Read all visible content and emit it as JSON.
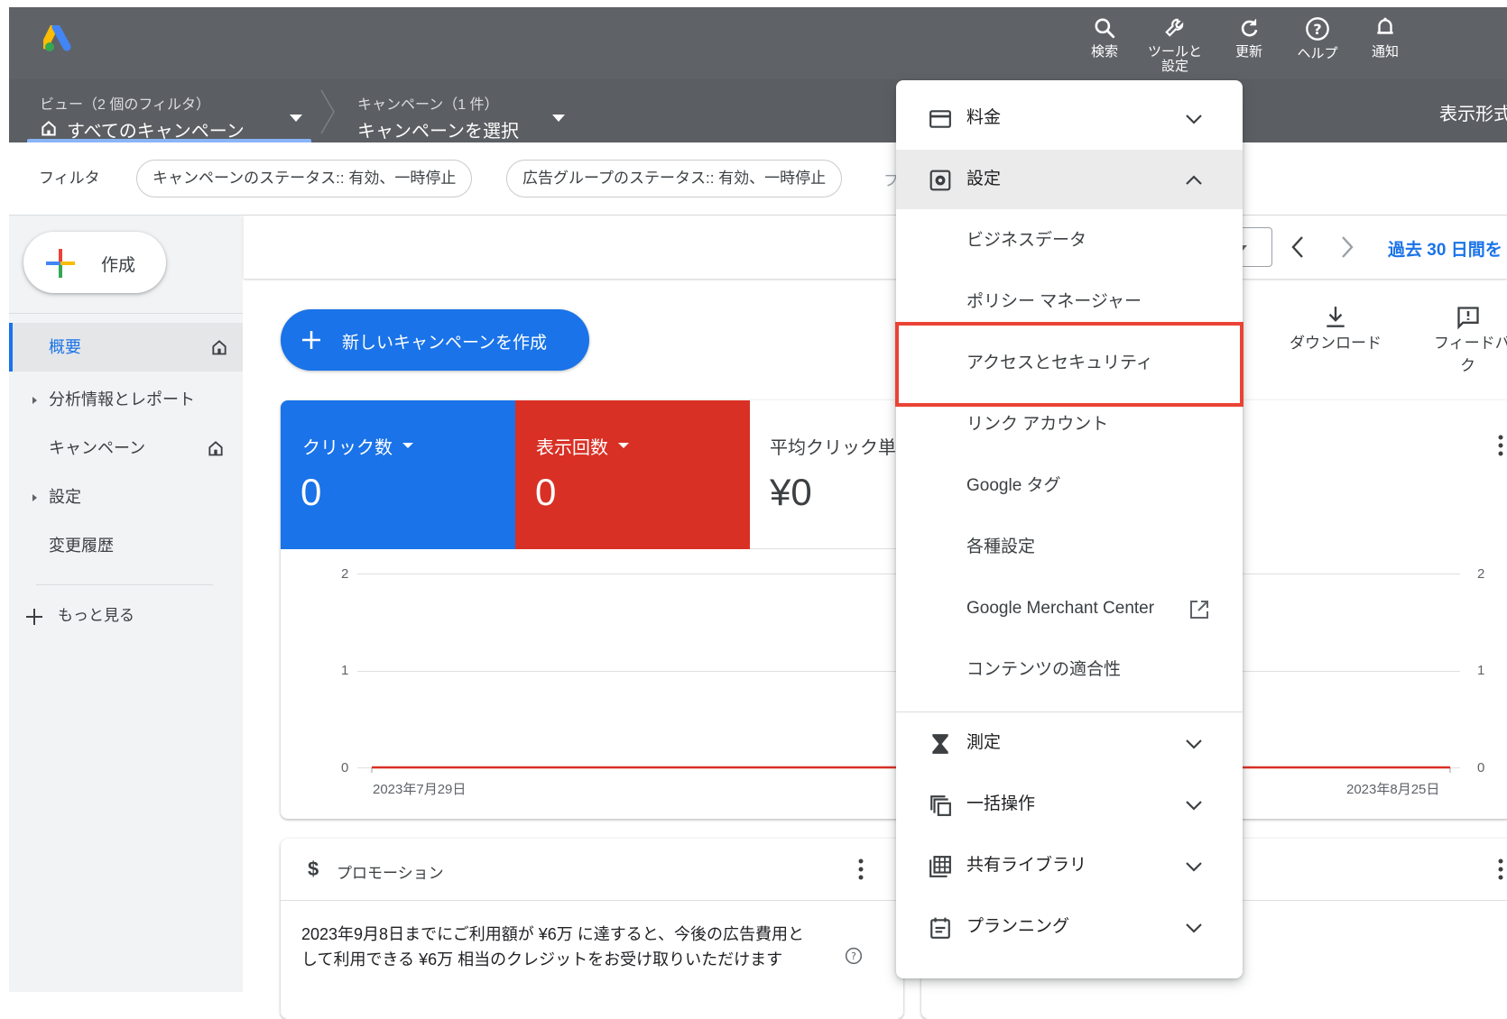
{
  "topbar": {
    "icons": [
      {
        "name": "search-icon",
        "label": "検索"
      },
      {
        "name": "wrench-icon",
        "label": "ツールと設定"
      },
      {
        "name": "refresh-icon",
        "label": "更新"
      },
      {
        "name": "help-icon",
        "label": "ヘルプ"
      },
      {
        "name": "bell-icon",
        "label": "通知"
      }
    ],
    "tools_line1": "ツールと",
    "tools_line2": "設定"
  },
  "breadcrumb": {
    "view_sub": "ビュー（2 個のフィルタ）",
    "view_main": "すべてのキャンペーン",
    "campaign_sub": "キャンペーン（1 件）",
    "campaign_main": "キャンペーンを選択",
    "display_format": "表示形式"
  },
  "filters": {
    "label": "フィルタ",
    "chips": [
      "キャンペーンのステータス:: 有効、一時停止",
      "広告グループのステータス:: 有効、一時停止"
    ],
    "overflow": "フ"
  },
  "sidebar": {
    "create_label": "作成",
    "items": [
      {
        "label": "概要",
        "active": true,
        "home": true,
        "caret": false
      },
      {
        "label": "分析情報とレポート",
        "active": false,
        "home": false,
        "caret": true
      },
      {
        "label": "キャンペーン",
        "active": false,
        "home": true,
        "caret": false
      },
      {
        "label": "設定",
        "active": false,
        "home": false,
        "caret": true
      },
      {
        "label": "変更履歴",
        "active": false,
        "home": false,
        "caret": false
      }
    ],
    "more_label": "もっと見る"
  },
  "toolbar": {
    "date_range": "過去 30 日間を",
    "download_label": "ダウンロード",
    "feedback_line1": "フィードバ",
    "feedback_line2": "ク"
  },
  "main": {
    "new_campaign_label": "新しいキャンペーンを作成",
    "metrics": [
      {
        "label": "クリック数",
        "value": "0",
        "color": "#1a73e8"
      },
      {
        "label": "表示回数",
        "value": "0",
        "color": "#d93025"
      },
      {
        "label": "平均クリック単",
        "value": "¥0",
        "color": "#ffffff"
      }
    ],
    "promo_title": "プロモーション",
    "promo_text_line1": "2023年9月8日までにご利用額が ¥6万 に達すると、今後の広告費用と",
    "promo_text_line2": "して利用できる ¥6万 相当のクレジットをお受け取りいただけます"
  },
  "chart_data": {
    "type": "line",
    "x_start_label": "2023年7月29日",
    "x_end_label": "2023年8月25日",
    "y_ticks": [
      "2",
      "1",
      "0"
    ],
    "ylim": [
      0,
      2
    ],
    "series": [
      {
        "values": [
          0,
          0
        ],
        "color": "#d93025"
      }
    ]
  },
  "menu": {
    "sections": [
      {
        "label": "料金",
        "icon": "credit-card-icon",
        "expanded": false
      },
      {
        "label": "設定",
        "icon": "settings-box-icon",
        "expanded": true
      }
    ],
    "settings_items": [
      {
        "label": "ビジネスデータ",
        "highlighted": false,
        "external": false
      },
      {
        "label": "ポリシー マネージャー",
        "highlighted": false,
        "external": false
      },
      {
        "label": "アクセスとセキュリティ",
        "highlighted": true,
        "external": false
      },
      {
        "label": "リンク アカウント",
        "highlighted": false,
        "external": false
      },
      {
        "label": "Google タグ",
        "highlighted": false,
        "external": false
      },
      {
        "label": "各種設定",
        "highlighted": false,
        "external": false
      },
      {
        "label": "Google Merchant Center",
        "highlighted": false,
        "external": true
      },
      {
        "label": "コンテンツの適合性",
        "highlighted": false,
        "external": false
      }
    ],
    "lower_sections": [
      {
        "label": "測定",
        "icon": "hourglass-icon"
      },
      {
        "label": "一括操作",
        "icon": "copy-stack-icon"
      },
      {
        "label": "共有ライブラリ",
        "icon": "library-grid-icon"
      },
      {
        "label": "プランニング",
        "icon": "calendar-plan-icon"
      }
    ],
    "highlight_color": "#ea4335"
  }
}
